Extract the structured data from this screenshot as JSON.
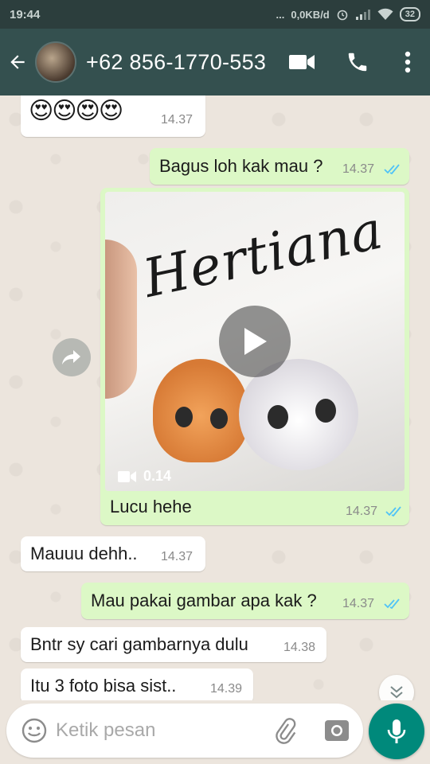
{
  "status_bar": {
    "time": "19:44",
    "dots": "...",
    "network_speed": "0,0KB/d",
    "battery": "32"
  },
  "header": {
    "contact_name": "+62 856-1770-553",
    "back_icon": "arrow-left-icon",
    "video_call_icon": "video-camera-icon",
    "call_icon": "phone-icon",
    "menu_icon": "more-vert-icon"
  },
  "messages": [
    {
      "direction": "in",
      "text": "😍😍😍😍",
      "time": "14.37"
    },
    {
      "direction": "out",
      "text": "Bagus loh kak mau ?",
      "time": "14.37",
      "read": true
    },
    {
      "direction": "out",
      "type": "video",
      "mug_text": "Hertiana",
      "duration": "0.14",
      "caption": "Lucu hehe",
      "time": "14.37",
      "read": true
    },
    {
      "direction": "in",
      "text": "Mauuu dehh..",
      "time": "14.37"
    },
    {
      "direction": "out",
      "text": "Mau pakai gambar apa kak ?",
      "time": "14.37",
      "read": true
    },
    {
      "direction": "in",
      "text": "Bntr sy cari gambarnya dulu",
      "time": "14.38"
    },
    {
      "direction": "in",
      "text": "Itu 3 foto bisa sist..",
      "time": "14.39"
    }
  ],
  "input": {
    "placeholder": "Ketik pesan"
  },
  "colors": {
    "header_bg": "#34504f",
    "status_bg": "#2c3e3d",
    "out_bubble": "#dcf8c6",
    "in_bubble": "#ffffff",
    "read_tick": "#4fc3f7",
    "mic_button": "#00897b"
  }
}
